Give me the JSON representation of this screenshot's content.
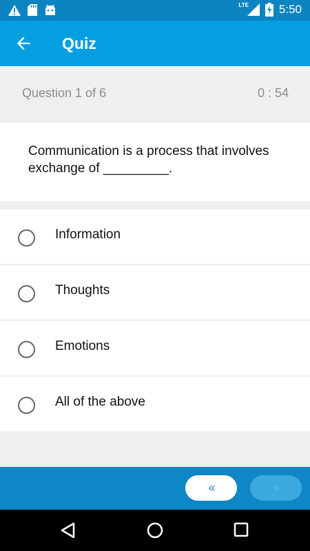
{
  "status_bar": {
    "network": "LTE",
    "battery_level": 0.5,
    "time": "5:50",
    "icons": [
      "warning-icon",
      "sd-card-icon",
      "android-icon",
      "signal-icon",
      "battery-charging-icon"
    ]
  },
  "app_bar": {
    "title": "Quiz",
    "back_icon": "arrow-left-icon",
    "color": "#049fe0"
  },
  "quiz": {
    "counter": "Question 1 of  6",
    "timer": "0 : 54",
    "question": "Communication is a process that involves exchange of _________.",
    "options": [
      {
        "label": "Information",
        "selected": false
      },
      {
        "label": "Thoughts",
        "selected": false
      },
      {
        "label": "Emotions",
        "selected": false
      },
      {
        "label": "All of the above",
        "selected": false
      }
    ]
  },
  "navigation": {
    "prev_label": "‹‹",
    "next_label": "››",
    "prev_enabled": true,
    "next_enabled": false
  },
  "system_nav": {
    "icons": [
      "back-triangle-icon",
      "home-circle-icon",
      "recents-square-icon"
    ]
  }
}
